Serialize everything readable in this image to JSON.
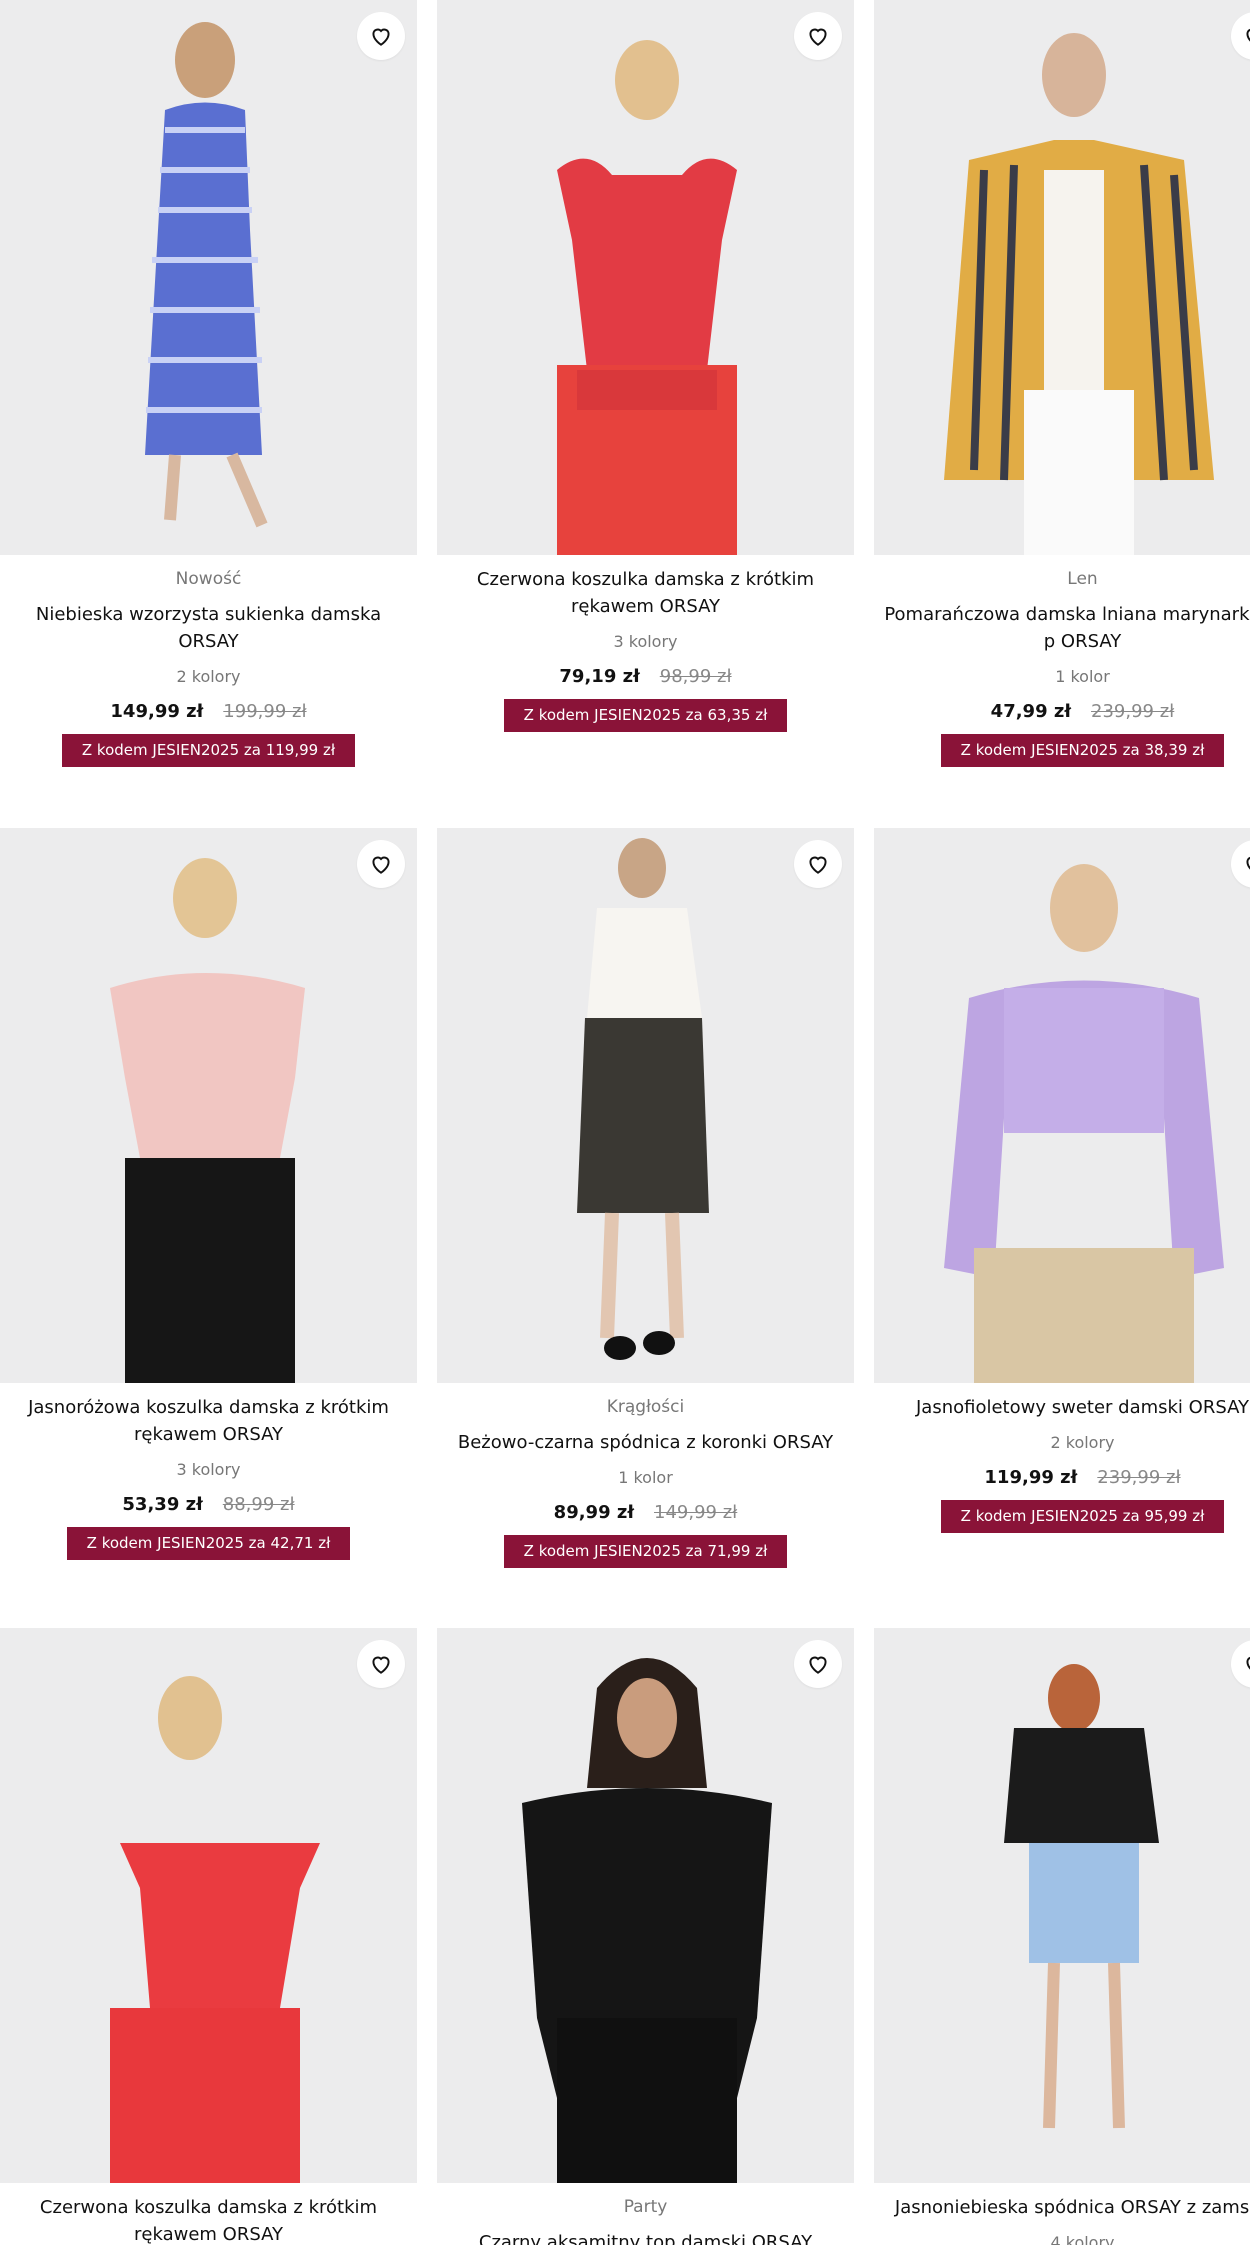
{
  "products": [
    {
      "tag": "Nowość",
      "title": "Niebieska wzorzysta sukienka damska ORSAY",
      "colors": "2 kolory",
      "price": "149,99 zł",
      "old_price": "199,99 zł",
      "promo": "Z kodem JESIEN2025 za 119,99 zł"
    },
    {
      "tag": "",
      "title": "Czerwona koszulka damska z krótkim rękawem ORSAY",
      "colors": "3 kolory",
      "price": "79,19 zł",
      "old_price": "98,99 zł",
      "promo": "Z kodem JESIEN2025 za 63,35 zł"
    },
    {
      "tag": "Len",
      "title": "Pomarańczowa damska lniana marynarka w p ORSAY",
      "colors": "1 kolor",
      "price": "47,99 zł",
      "old_price": "239,99 zł",
      "promo": "Z kodem JESIEN2025 za 38,39 zł"
    },
    {
      "tag": "",
      "title": "Jasnoróżowa koszulka damska z krótkim rękawem ORSAY",
      "colors": "3 kolory",
      "price": "53,39 zł",
      "old_price": "88,99 zł",
      "promo": "Z kodem JESIEN2025 za 42,71 zł"
    },
    {
      "tag": "Krągłości",
      "title": "Beżowo-czarna spódnica z koronki ORSAY",
      "colors": "1 kolor",
      "price": "89,99 zł",
      "old_price": "149,99 zł",
      "promo": "Z kodem JESIEN2025 za 71,99 zł"
    },
    {
      "tag": "",
      "title": "Jasnofioletowy sweter damski ORSAY",
      "colors": "2 kolory",
      "price": "119,99 zł",
      "old_price": "239,99 zł",
      "promo": "Z kodem JESIEN2025 za 95,99 zł"
    },
    {
      "tag": "",
      "title": "Czerwona koszulka damska z krótkim rękawem ORSAY",
      "colors": "",
      "price": "",
      "old_price": "",
      "promo": ""
    },
    {
      "tag": "Party",
      "title": "Czarny aksamitny top damski ORSAY",
      "colors": "",
      "price": "",
      "old_price": "",
      "promo": ""
    },
    {
      "tag": "",
      "title": "Jasnoniebieska spódnica ORSAY z zamszu",
      "colors": "4 kolory",
      "price": "",
      "old_price": "",
      "promo": ""
    }
  ],
  "icons": {
    "favorite": "heart-outline-icon"
  },
  "colors": {
    "promo_bg": "#8a1338",
    "image_bg": "#eeeeef"
  }
}
